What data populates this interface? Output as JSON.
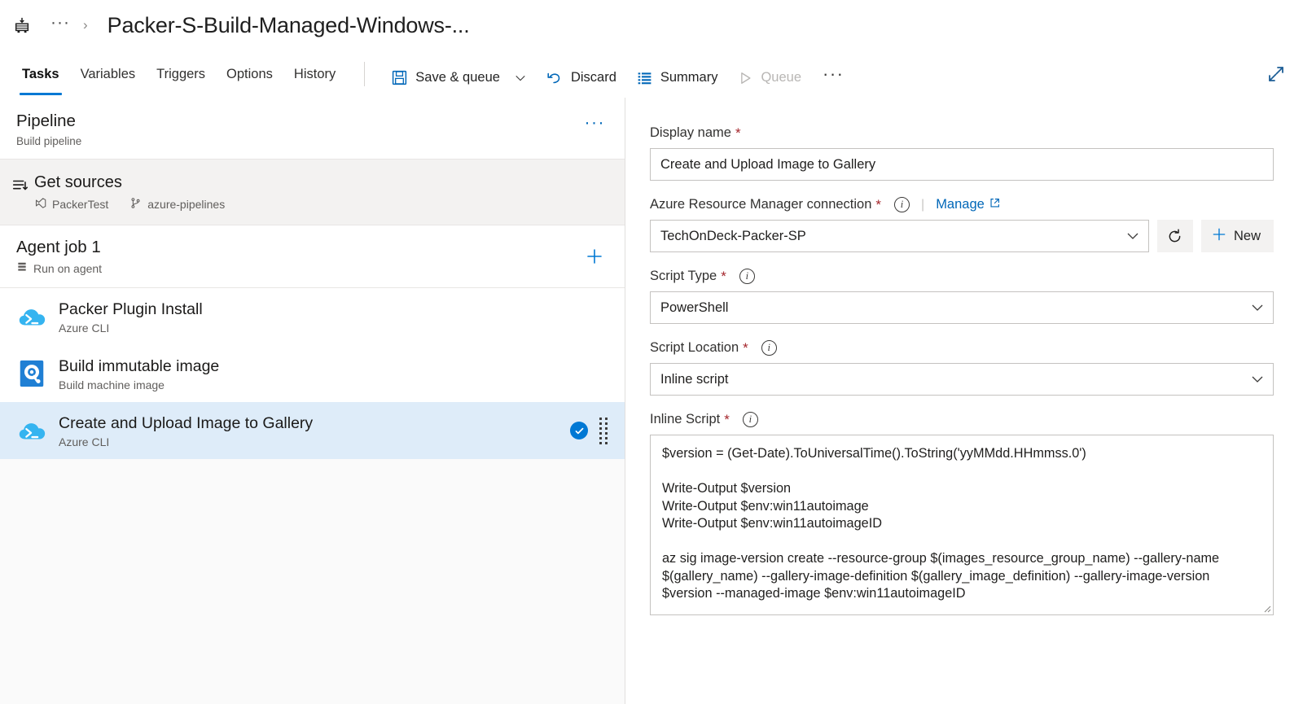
{
  "breadcrumb": {
    "logo_icon": "azure-pipelines-logo-icon",
    "ellipsis": "···",
    "separator": "›",
    "title": "Packer-S-Build-Managed-Windows-..."
  },
  "toolbar": {
    "tabs": [
      {
        "label": "Tasks",
        "active": true
      },
      {
        "label": "Variables",
        "active": false
      },
      {
        "label": "Triggers",
        "active": false
      },
      {
        "label": "Options",
        "active": false
      },
      {
        "label": "History",
        "active": false
      }
    ],
    "actions": {
      "save_queue": "Save & queue",
      "discard": "Discard",
      "summary": "Summary",
      "queue": "Queue",
      "overflow": "···"
    },
    "expand_icon": "expand-diagonal-icon"
  },
  "left_panel": {
    "pipeline": {
      "title": "Pipeline",
      "subtitle": "Build pipeline",
      "menu": "···"
    },
    "get_sources": {
      "title": "Get sources",
      "repo": "PackerTest",
      "branch": "azure-pipelines"
    },
    "agent_job": {
      "title": "Agent job 1",
      "subtitle": "Run on agent",
      "add_label": "+"
    },
    "tasks": [
      {
        "title": "Packer Plugin Install",
        "subtitle": "Azure CLI",
        "icon": "azure-cli-icon",
        "selected": false
      },
      {
        "title": "Build immutable image",
        "subtitle": "Build machine image",
        "icon": "packer-disk-icon",
        "selected": false
      },
      {
        "title": "Create and Upload Image to Gallery",
        "subtitle": "Azure CLI",
        "icon": "azure-cli-icon",
        "selected": true
      }
    ]
  },
  "form": {
    "display_name": {
      "label": "Display name",
      "value": "Create and Upload Image to Gallery"
    },
    "arm_connection": {
      "label": "Azure Resource Manager connection",
      "value": "TechOnDeck-Packer-SP",
      "manage_link": "Manage",
      "refresh_icon": "refresh-icon",
      "new_label": "New"
    },
    "script_type": {
      "label": "Script Type",
      "value": "PowerShell"
    },
    "script_location": {
      "label": "Script Location",
      "value": "Inline script"
    },
    "inline_script": {
      "label": "Inline Script",
      "value": "$version = (Get-Date).ToUniversalTime().ToString('yyMMdd.HHmmss.0')\n\nWrite-Output $version\nWrite-Output $env:win11autoimage\nWrite-Output $env:win11autoimageID\n\naz sig image-version create --resource-group $(images_resource_group_name) --gallery-name $(gallery_name) --gallery-image-definition $(gallery_image_definition) --gallery-image-version $version --managed-image $env:win11autoimageID"
    },
    "required_marker": "*"
  },
  "colors": {
    "accent": "#0078d4",
    "link": "#0067b8",
    "required": "#a4262c",
    "selected_row": "#deecf9",
    "panel_bg": "#f3f2f1"
  }
}
